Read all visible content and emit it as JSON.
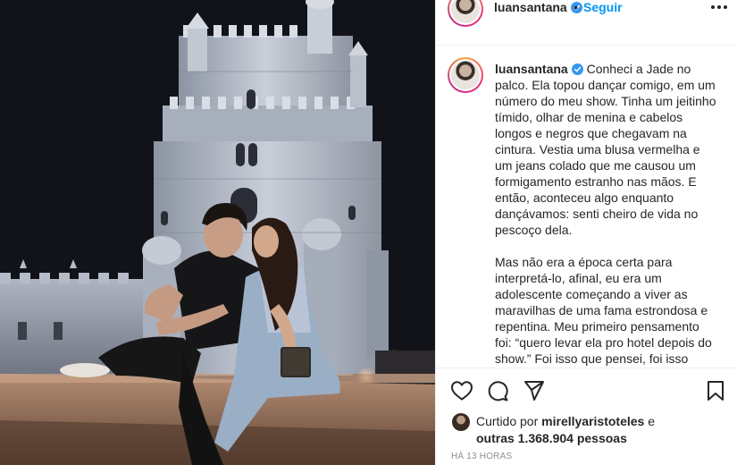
{
  "post": {
    "username": "luansantana",
    "follow_label": "Seguir",
    "separator": "•",
    "caption": [
      "Conheci a Jade no palco. Ela topou dançar comigo, em um número do meu show. Tinha um jeitinho tímido, olhar de menina e cabelos longos e negros que chegavam na cintura. Vestia uma blusa vermelha e um jeans colado que me causou um formigamento estranho nas mãos. E então, aconteceu algo enquanto dançávamos: senti cheiro de vida no pescoço dela.",
      "Mas não era a época certa para interpretá-lo, afinal, eu era um adolescente começando a viver as maravilhas de uma fama estrondosa e repentina. Meu primeiro pensamento foi: “quero levar ela pro hotel depois do show.” Foi isso que pensei, foi isso"
    ],
    "likes": {
      "prefix": "Curtido por",
      "liked_by": "mirellyaristoteles",
      "conjunction": "e",
      "others": "outras 1.368.904 pessoas"
    },
    "timestamp": "HÁ 13 HORAS"
  },
  "icons": {
    "verified": "verified-badge-icon",
    "more": "more-options-icon",
    "like": "heart-icon",
    "comment": "comment-icon",
    "share": "paper-plane-icon",
    "save": "bookmark-icon"
  },
  "colors": {
    "accent": "#0095f6",
    "text": "#262626",
    "muted": "#8e8e8e",
    "divider": "#efefef"
  }
}
